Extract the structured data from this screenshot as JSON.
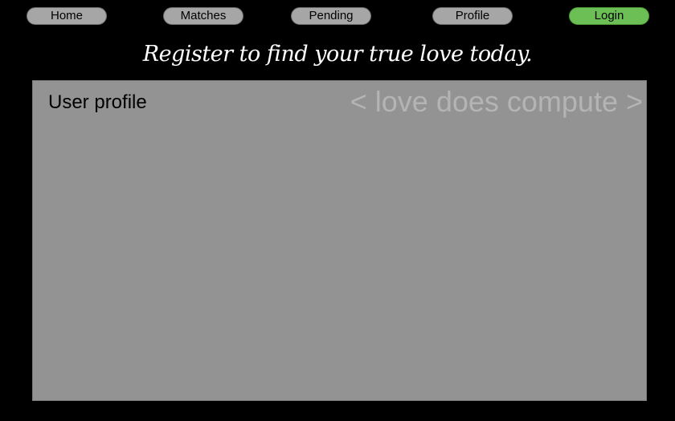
{
  "nav": {
    "items": [
      {
        "label": "Home"
      },
      {
        "label": "Matches"
      },
      {
        "label": "Pending"
      },
      {
        "label": "Profile"
      },
      {
        "label": "Login",
        "active": true
      }
    ]
  },
  "header": {
    "tagline": "Register to find your true love today."
  },
  "panel": {
    "title": "User profile",
    "watermark": "< love does compute >"
  },
  "colors": {
    "background": "#000000",
    "nav_button": "#a6a6a6",
    "nav_button_active": "#6cbf55",
    "panel": "#939393",
    "watermark": "#b4b4b4"
  }
}
